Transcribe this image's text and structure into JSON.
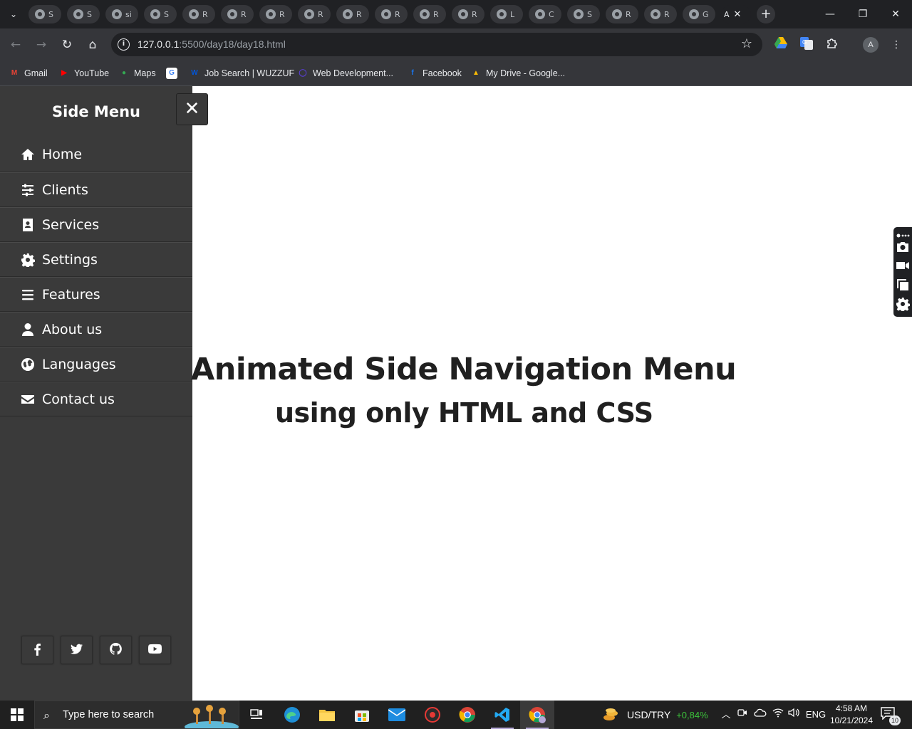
{
  "browser": {
    "tabs": [
      {
        "label": "S"
      },
      {
        "label": "S"
      },
      {
        "label": "si"
      },
      {
        "label": "S"
      },
      {
        "label": "R"
      },
      {
        "label": "R"
      },
      {
        "label": "R"
      },
      {
        "label": "R"
      },
      {
        "label": "R"
      },
      {
        "label": "R"
      },
      {
        "label": "R"
      },
      {
        "label": "R"
      },
      {
        "label": "L"
      },
      {
        "label": "C"
      },
      {
        "label": "S"
      },
      {
        "label": "R"
      },
      {
        "label": "R"
      },
      {
        "label": "G"
      }
    ],
    "active_tab": {
      "label": "A",
      "close": "✕"
    },
    "new_tab": "+",
    "window_controls": {
      "minimize": "—",
      "restore": "❐",
      "close": "✕"
    },
    "url": {
      "host": "127.0.0.1",
      "path": ":5500/day18/day18.html"
    },
    "profile_initial": "A",
    "bookmarks": [
      {
        "label": "Gmail",
        "icon": "gmail-icon",
        "color": "#ea4335",
        "glyph": "M"
      },
      {
        "label": "YouTube",
        "icon": "youtube-icon",
        "color": "#ff0000",
        "glyph": "▶"
      },
      {
        "label": "Maps",
        "icon": "maps-icon",
        "color": "#34a853",
        "glyph": "●"
      },
      {
        "label": "",
        "icon": "google-icon",
        "color": "#ffffff",
        "glyph": "G"
      },
      {
        "label": "Job Search | WUZZUF",
        "icon": "wuzzuf-icon",
        "color": "#0055d9",
        "glyph": "W"
      },
      {
        "label": "Web Development...",
        "icon": "webdev-icon",
        "color": "#5a3fd6",
        "glyph": "◯"
      },
      {
        "label": "Facebook",
        "icon": "facebook-icon",
        "color": "#1877f2",
        "glyph": "f"
      },
      {
        "label": "My Drive - Google...",
        "icon": "drive-icon",
        "color": "#fbbc04",
        "glyph": "▲"
      }
    ]
  },
  "page": {
    "side_title": "Side Menu",
    "close_label": "✕",
    "menu": [
      {
        "label": "Home",
        "icon": "home-icon"
      },
      {
        "label": "Clients",
        "icon": "sliders-icon"
      },
      {
        "label": "Services",
        "icon": "id-card-icon"
      },
      {
        "label": "Settings",
        "icon": "gear-icon"
      },
      {
        "label": "Features",
        "icon": "bars-icon"
      },
      {
        "label": "About us",
        "icon": "user-icon"
      },
      {
        "label": "Languages",
        "icon": "globe-icon"
      },
      {
        "label": "Contact us",
        "icon": "envelope-icon"
      }
    ],
    "social": [
      "facebook-icon",
      "twitter-icon",
      "github-icon",
      "youtube-icon"
    ],
    "headline_1": "Animated Side Navigation Menu",
    "headline_2": "using only HTML and CSS",
    "text_color": "#202020",
    "sidebar_color": "#3a3a3a"
  },
  "taskbar": {
    "search_placeholder": "Type here to search",
    "ticker_symbol": "USD/TRY",
    "ticker_change": "+0,84%",
    "language": "ENG",
    "time": "4:58 AM",
    "date": "10/21/2024",
    "notifications": "10"
  }
}
